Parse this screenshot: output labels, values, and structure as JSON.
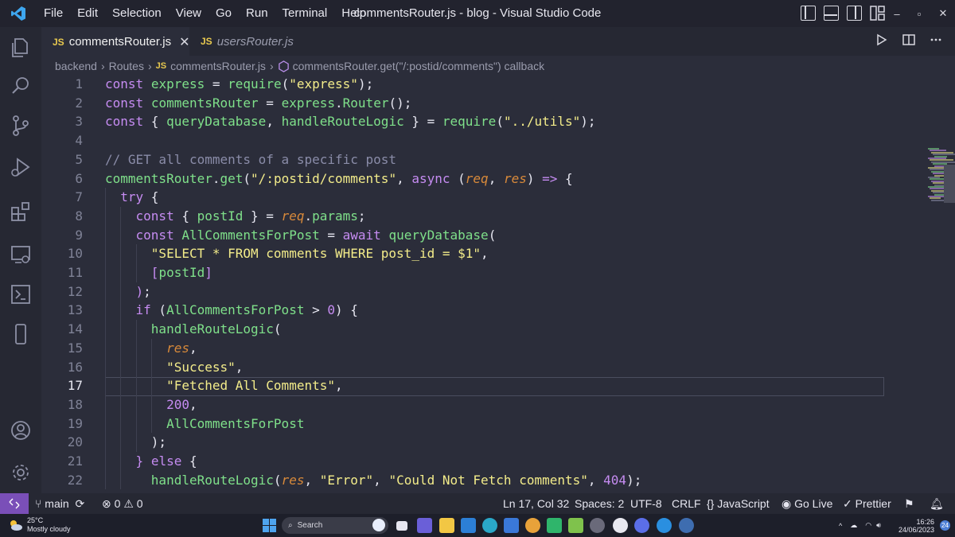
{
  "titlebar": {
    "menu": [
      "File",
      "Edit",
      "Selection",
      "View",
      "Go",
      "Run",
      "Terminal",
      "Help"
    ],
    "window_title": "commentsRouter.js - blog - Visual Studio Code",
    "win_minimize": "–",
    "win_restore": "▫",
    "win_close": "✕"
  },
  "tabs": [
    {
      "badge": "JS",
      "label": "commentsRouter.js",
      "close": "✕"
    },
    {
      "badge": "JS",
      "label": "usersRouter.js"
    }
  ],
  "breadcrumb": {
    "items": [
      "backend",
      "Routes",
      "commentsRouter.js",
      "commentsRouter.get(\"/:postid/comments\") callback"
    ],
    "file_badge": "JS"
  },
  "editor": {
    "current_line": 17,
    "lines": [
      {
        "n": "1"
      },
      {
        "n": "2"
      },
      {
        "n": "3"
      },
      {
        "n": "4"
      },
      {
        "n": "5"
      },
      {
        "n": "6"
      },
      {
        "n": "7"
      },
      {
        "n": "8"
      },
      {
        "n": "9"
      },
      {
        "n": "10"
      },
      {
        "n": "11"
      },
      {
        "n": "12"
      },
      {
        "n": "13"
      },
      {
        "n": "14"
      },
      {
        "n": "15"
      },
      {
        "n": "16"
      },
      {
        "n": "17"
      },
      {
        "n": "18"
      },
      {
        "n": "19"
      },
      {
        "n": "20"
      },
      {
        "n": "21"
      },
      {
        "n": "22"
      }
    ],
    "code": [
      [
        [
          "kw",
          "const"
        ],
        [
          "punc",
          " "
        ],
        [
          "var",
          "express"
        ],
        [
          "punc",
          " = "
        ],
        [
          "fn",
          "require"
        ],
        [
          "punc",
          "("
        ],
        [
          "str",
          "\"express\""
        ],
        [
          "punc",
          ");"
        ]
      ],
      [
        [
          "kw",
          "const"
        ],
        [
          "punc",
          " "
        ],
        [
          "var",
          "commentsRouter"
        ],
        [
          "punc",
          " = "
        ],
        [
          "var",
          "express"
        ],
        [
          "punc",
          "."
        ],
        [
          "fn",
          "Router"
        ],
        [
          "punc",
          "();"
        ]
      ],
      [
        [
          "kw",
          "const"
        ],
        [
          "punc",
          " { "
        ],
        [
          "var",
          "queryDatabase"
        ],
        [
          "punc",
          ", "
        ],
        [
          "var",
          "handleRouteLogic"
        ],
        [
          "punc",
          " } = "
        ],
        [
          "fn",
          "require"
        ],
        [
          "punc",
          "("
        ],
        [
          "str",
          "\"../utils\""
        ],
        [
          "punc",
          ");"
        ]
      ],
      [],
      [
        [
          "cm",
          "// GET all comments of a specific post"
        ]
      ],
      [
        [
          "var",
          "commentsRouter"
        ],
        [
          "punc",
          "."
        ],
        [
          "fn",
          "get"
        ],
        [
          "punc",
          "("
        ],
        [
          "str",
          "\"/:postid/comments\""
        ],
        [
          "punc",
          ", "
        ],
        [
          "kw",
          "async"
        ],
        [
          "punc",
          " ("
        ],
        [
          "par",
          "req"
        ],
        [
          "punc",
          ", "
        ],
        [
          "par",
          "res"
        ],
        [
          "punc",
          ") "
        ],
        [
          "kw",
          "=>"
        ],
        [
          "punc",
          " {"
        ]
      ],
      [
        [
          "punc",
          "  "
        ],
        [
          "kw",
          "try"
        ],
        [
          "punc",
          " {"
        ]
      ],
      [
        [
          "punc",
          "    "
        ],
        [
          "kw",
          "const"
        ],
        [
          "punc",
          " { "
        ],
        [
          "var",
          "postId"
        ],
        [
          "punc",
          " } = "
        ],
        [
          "par",
          "req"
        ],
        [
          "punc",
          "."
        ],
        [
          "var",
          "params"
        ],
        [
          "punc",
          ";"
        ]
      ],
      [
        [
          "punc",
          "    "
        ],
        [
          "kw",
          "const"
        ],
        [
          "punc",
          " "
        ],
        [
          "var",
          "AllCommentsForPost"
        ],
        [
          "punc",
          " = "
        ],
        [
          "kw",
          "await"
        ],
        [
          "punc",
          " "
        ],
        [
          "fn",
          "queryDatabase"
        ],
        [
          "punc",
          "("
        ]
      ],
      [
        [
          "punc",
          "      "
        ],
        [
          "str",
          "\"SELECT * FROM comments WHERE post_id = $1\""
        ],
        [
          "punc",
          ","
        ]
      ],
      [
        [
          "punc",
          "      "
        ],
        [
          "kw",
          "["
        ],
        [
          "var",
          "postId"
        ],
        [
          "kw",
          "]"
        ]
      ],
      [
        [
          "punc",
          "    "
        ],
        [
          "kw",
          ")"
        ],
        [
          "punc",
          ";"
        ]
      ],
      [
        [
          "punc",
          "    "
        ],
        [
          "kw",
          "if"
        ],
        [
          "punc",
          " ("
        ],
        [
          "var",
          "AllCommentsForPost"
        ],
        [
          "punc",
          " > "
        ],
        [
          "num",
          "0"
        ],
        [
          "punc",
          ") {"
        ]
      ],
      [
        [
          "punc",
          "      "
        ],
        [
          "fn",
          "handleRouteLogic"
        ],
        [
          "punc",
          "("
        ]
      ],
      [
        [
          "punc",
          "        "
        ],
        [
          "par",
          "res"
        ],
        [
          "punc",
          ","
        ]
      ],
      [
        [
          "punc",
          "        "
        ],
        [
          "str",
          "\"Success\""
        ],
        [
          "punc",
          ","
        ]
      ],
      [
        [
          "punc",
          "        "
        ],
        [
          "str",
          "\"Fetched All Comments\""
        ],
        [
          "punc",
          ","
        ]
      ],
      [
        [
          "punc",
          "        "
        ],
        [
          "num",
          "200"
        ],
        [
          "punc",
          ","
        ]
      ],
      [
        [
          "punc",
          "        "
        ],
        [
          "var",
          "AllCommentsForPost"
        ]
      ],
      [
        [
          "punc",
          "      "
        ],
        [
          "punc",
          ");"
        ]
      ],
      [
        [
          "punc",
          "    "
        ],
        [
          "kw",
          "}"
        ],
        [
          "punc",
          " "
        ],
        [
          "kw",
          "else"
        ],
        [
          "punc",
          " {"
        ]
      ],
      [
        [
          "punc",
          "      "
        ],
        [
          "fn",
          "handleRouteLogic"
        ],
        [
          "punc",
          "("
        ],
        [
          "par",
          "res"
        ],
        [
          "punc",
          ", "
        ],
        [
          "str",
          "\"Error\""
        ],
        [
          "punc",
          ", "
        ],
        [
          "str",
          "\"Could Not Fetch comments\""
        ],
        [
          "punc",
          ", "
        ],
        [
          "num",
          "404"
        ],
        [
          "punc",
          ");"
        ]
      ]
    ]
  },
  "statusbar": {
    "branch": "main",
    "errors": "0",
    "warnings": "0",
    "position": "Ln 17, Col 32",
    "spaces": "Spaces: 2",
    "encoding": "UTF-8",
    "eol": "CRLF",
    "language": "JavaScript",
    "golive": "Go Live",
    "prettier": "Prettier"
  },
  "taskbar": {
    "temperature": "25°C",
    "weather": "Mostly cloudy",
    "search_placeholder": "Search",
    "time": "16:26",
    "date": "24/06/2023",
    "notifications": "24"
  },
  "colors": {
    "keyword": "#c68cf2",
    "variable": "#7fe08a",
    "string": "#f3ec8a",
    "parameter": "#d98a3a",
    "comment": "#8a8ca8",
    "remote_indicator": "#7a4fb8"
  }
}
